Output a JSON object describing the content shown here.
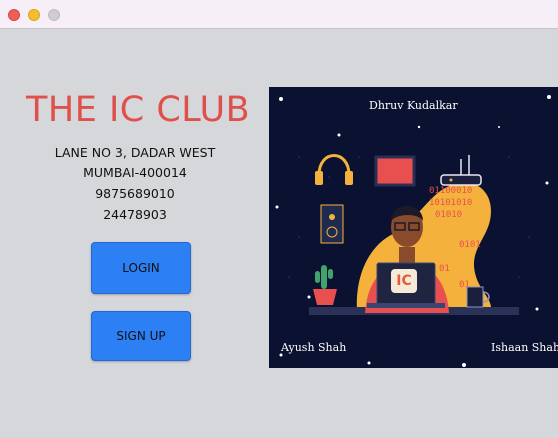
{
  "club": {
    "title": "THE IC CLUB",
    "address_line1": "LANE NO 3, DADAR WEST",
    "address_line2": "MUMBAI-400014",
    "phone1": "9875689010",
    "phone2": "24478903"
  },
  "buttons": {
    "login": "LOGIN",
    "signup": "SIGN UP"
  },
  "poster": {
    "name_top": "Dhruv Kudalkar",
    "name_bottom_left": "Ayush Shah",
    "name_bottom_right": "Ishaan Shah",
    "laptop_logo": "IC",
    "binary_line1": "01100010",
    "binary_line2": "10101010",
    "binary_line3": "01010",
    "binary_line4": "0101",
    "binary_line5": "01",
    "binary_line6": "01",
    "icons": [
      "headphones-icon",
      "monitor-icon",
      "router-icon",
      "speaker-icon",
      "cactus-icon",
      "mug-icon",
      "laptop-icon"
    ]
  },
  "colors": {
    "title": "#e0504a",
    "button": "#2d7ff4",
    "poster_bg": "#0b1130",
    "poster_accent": "#f4b23c"
  }
}
